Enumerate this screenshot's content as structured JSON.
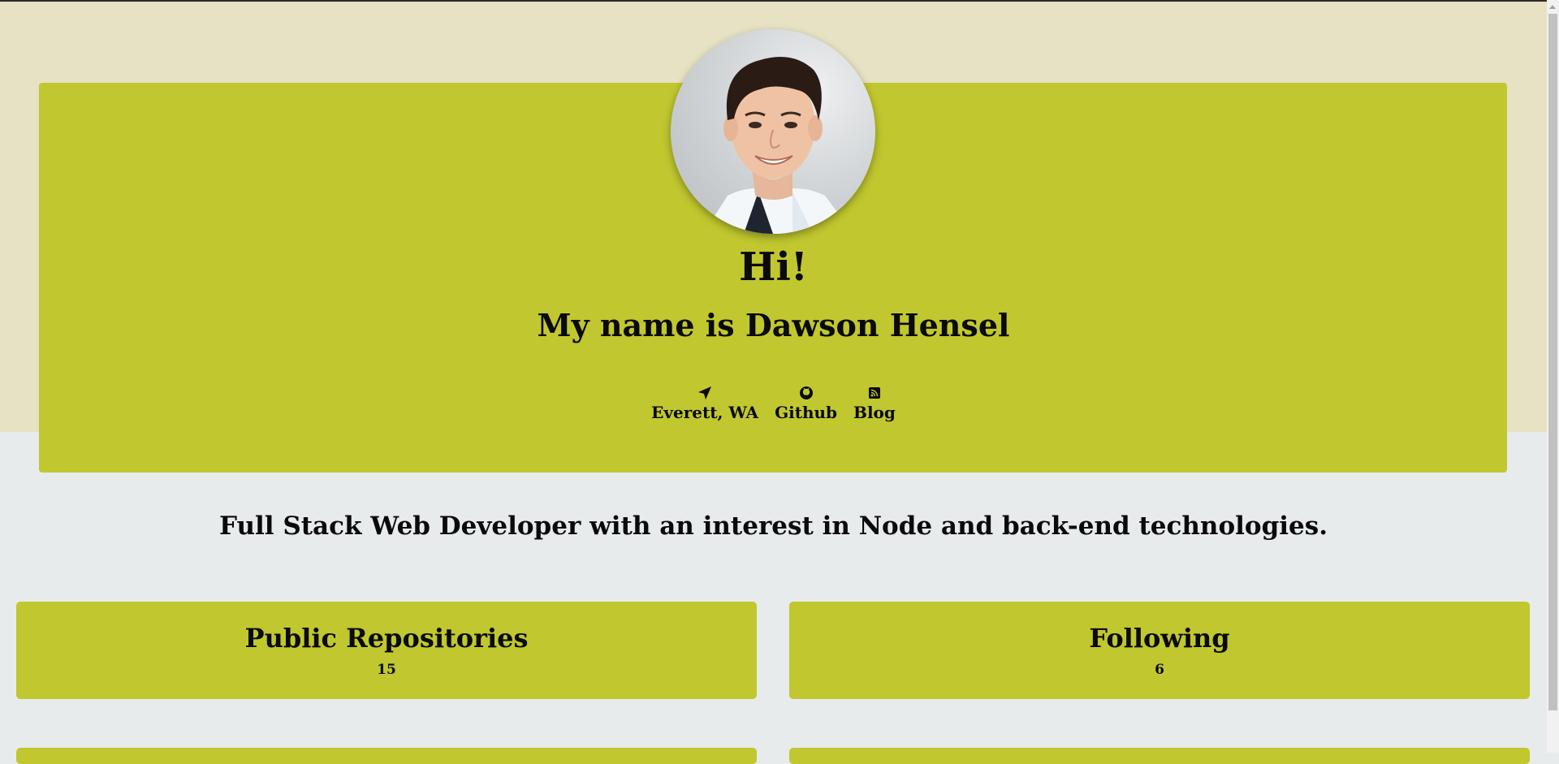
{
  "profile": {
    "greeting": "Hi!",
    "name": "My name is Dawson Hensel",
    "avatar_alt": "Dawson Hensel"
  },
  "links": [
    {
      "label": "Everett, WA",
      "icon": "location-arrow-icon"
    },
    {
      "label": "Github",
      "icon": "github-icon"
    },
    {
      "label": "Blog",
      "icon": "rss-icon"
    }
  ],
  "tagline": "Full Stack Web Developer with an interest in Node and back-end technologies.",
  "stats": [
    {
      "title": "Public Repositories",
      "value": "15"
    },
    {
      "title": "Following",
      "value": "6"
    }
  ],
  "colors": {
    "accent": "#c1c72e",
    "hero_background": "#e6e2c3",
    "page_background": "#e8ebec",
    "text": "#0a0a0a"
  }
}
